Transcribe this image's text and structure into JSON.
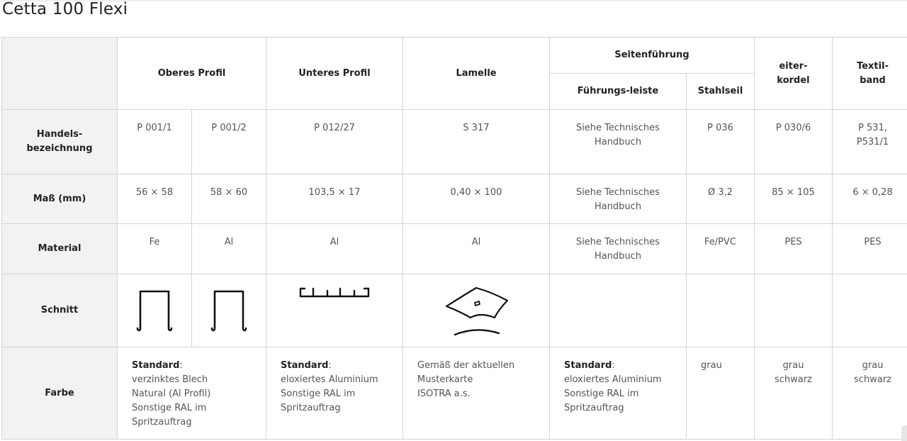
{
  "page": {
    "title": "Cetta 100 Flexi"
  },
  "table": {
    "headers": {
      "oberes_profil": "Oberes Profil",
      "unteres_profil": "Unteres Profil",
      "lamelle": "Lamelle",
      "seitenfuehrung": "Seitenführung",
      "fuehrungsleiste": "Führungs-leiste",
      "stahlseil": "Stahlseil",
      "leiterkordel_line1": "eiter-",
      "leiterkordel_line2": "kordel",
      "textilband_line1": "Textil-",
      "textilband_line2": "band"
    },
    "row_labels": {
      "handels_line1": "Handels-",
      "handels_line2": "bezeichnung",
      "mass": "Maß (mm)",
      "material": "Material",
      "schnitt": "Schnitt",
      "farbe": "Farbe"
    },
    "handelsbezeichnung": {
      "ob1": "P 001/1",
      "ob2": "P 001/2",
      "unt": "P 012/27",
      "lam": "S 317",
      "fl_line1": "Siehe Technisches",
      "fl_line2": "Handbuch",
      "ss": "P 036",
      "lk": "P 030/6",
      "tb_line1": "P 531,",
      "tb_line2": "P531/1"
    },
    "mass": {
      "ob1": "56 × 58",
      "ob2": "58 × 60",
      "unt": "103,5 × 17",
      "lam": "0,40 × 100",
      "fl_line1": "Siehe Technisches",
      "fl_line2": "Handbuch",
      "ss": "Ø 3,2",
      "lk": "85 × 105",
      "tb": "6 × 0,28"
    },
    "material": {
      "ob1": "Fe",
      "ob2": "Al",
      "unt": "Al",
      "lam": "Al",
      "fl_line1": "Siehe Technisches",
      "fl_line2": "Handbuch",
      "ss": "Fe/PVC",
      "lk": "PES",
      "tb": "PES"
    },
    "schnitt_icons": {
      "ob1": "u-profile-section-icon",
      "ob2": "u-profile-section-icon",
      "unt": "bottom-rail-section-icon",
      "lam": "slat-section-icon"
    },
    "farbe": {
      "oberes": {
        "bold": "Standard",
        "colon": ":",
        "lines": [
          "verzinktes Blech",
          "Natural (Al Profil)",
          "Sonstige RAL im",
          "Spritzauftrag"
        ]
      },
      "unteres": {
        "bold": "Standard",
        "colon": ":",
        "lines": [
          "eloxiertes Aluminium",
          "Sonstige RAL im",
          "Spritzauftrag"
        ]
      },
      "lamelle": {
        "lines": [
          "Gemäß der aktuellen",
          "Musterkarte",
          "ISOTRA a.s."
        ]
      },
      "fuehrung": {
        "bold": "Standard",
        "colon": ":",
        "lines": [
          "eloxiertes Aluminium",
          "Sonstige RAL im",
          "Spritzauftrag"
        ]
      },
      "ss": "grau",
      "lk_line1": "grau",
      "lk_line2": "schwarz",
      "tb_line1": "grau",
      "tb_line2": "schwarz"
    }
  },
  "colors": {
    "row_header_bg": "#f2f2f2",
    "border": "#d4d4d4",
    "text": "#555555"
  }
}
